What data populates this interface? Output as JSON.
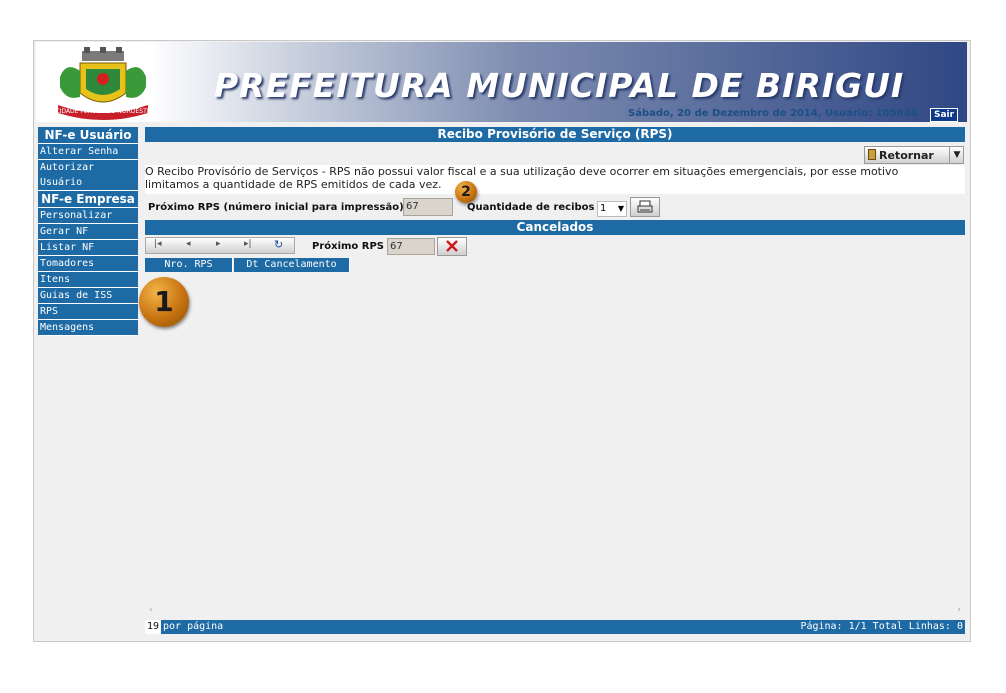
{
  "header": {
    "title": "PREFEITURA MUNICIPAL DE BIRIGUI",
    "crest_banner": "CIDADE PÉROLA DO NOROESTE",
    "date_user": "Sábado, 20 de Dezembro de 2014, Usuário: 105634",
    "logout_label": "Sair"
  },
  "sidebar": {
    "sections": [
      {
        "title": "NF-e Usuário",
        "items": [
          "Alterar Senha",
          "Autorizar Usuário"
        ]
      },
      {
        "title": "NF-e Empresa",
        "items": [
          "Personalizar",
          "Gerar NF",
          "Listar NF",
          "Tomadores",
          "Itens",
          "Guias de ISS",
          "RPS",
          "Mensagens"
        ]
      }
    ]
  },
  "main": {
    "title": "Recibo Provisório de Serviço (RPS)",
    "back_button": "Retornar",
    "info_line1": "O Recibo Provisório de Serviços - RPS não possui valor fiscal e a sua utilização deve ocorrer em situações emergenciais, por esse motivo",
    "info_line2": "limitamos a quantidade de RPS emitidos de cada vez.",
    "next_rps_label": "Próximo RPS (número inicial para impressão)",
    "next_rps_value": "67",
    "quantity_label": "Quantidade de recibos",
    "quantity_value": "1"
  },
  "cancelados": {
    "title": "Cancelados",
    "next_rps_label": "Próximo RPS",
    "next_rps_value": "67",
    "columns": [
      "Nro. RPS",
      "Dt Cancelamento"
    ]
  },
  "footer": {
    "per_page_value": "19",
    "per_page_label": "por página",
    "status": "Página: 1/1 Total Linhas: 0"
  },
  "badges": [
    "1",
    "2"
  ],
  "colors": {
    "accent": "#1d6aa5",
    "badge": "#c77410"
  }
}
